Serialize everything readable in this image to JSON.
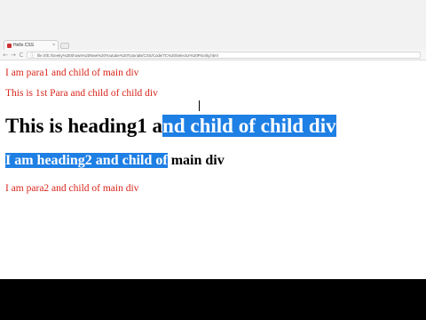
{
  "browser": {
    "tab_title": "Hello CSS",
    "tab_close": "×",
    "nav": {
      "back": "←",
      "forward": "→",
      "reload": "C"
    },
    "url": "file:///E:/Geeky%20Shows%20New%20Youtube%20Tutorials/CSS/Code/7C%20Selector%20Priority.html",
    "url_info_icon": "ⓘ"
  },
  "page": {
    "para1": "I am para1 and child of main div",
    "para_child": "This is 1st Para and child of child div",
    "heading1_plain": "This is heading1 a",
    "heading1_selected": "nd child of child div ",
    "heading2_selected": "I am heading2 and child of",
    "heading2_plain": " main div",
    "para2": "I am para2 and child of main div"
  },
  "colors": {
    "paragraph_text": "#d9261c",
    "selection_bg": "#1e7fe4"
  }
}
